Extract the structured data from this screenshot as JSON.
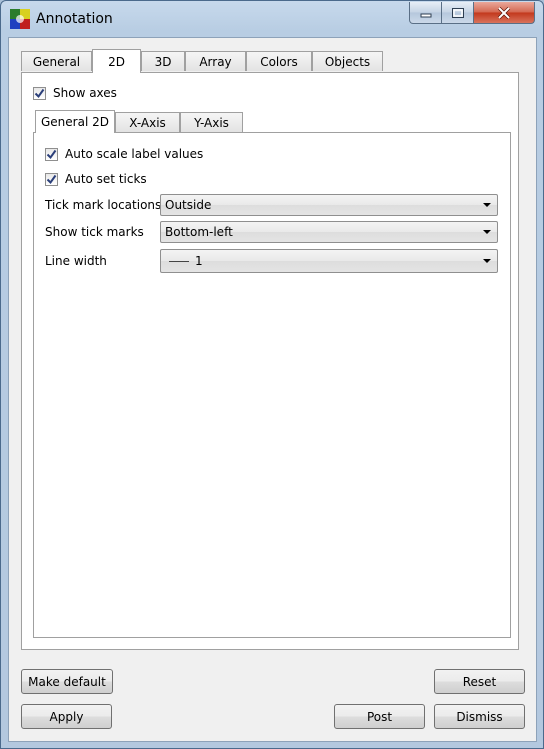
{
  "window": {
    "title": "Annotation",
    "icon": "annotation-app-icon",
    "controls": [
      "minimize-icon",
      "maximize-icon",
      "close-icon"
    ]
  },
  "tabs": [
    "General",
    "2D",
    "3D",
    "Array",
    "Colors",
    "Objects"
  ],
  "active_tab": "2D",
  "show_axes": {
    "label": "Show axes",
    "checked": true
  },
  "inner_tabs": [
    "General 2D",
    "X-Axis",
    "Y-Axis"
  ],
  "active_inner_tab": "General 2D",
  "general2d": {
    "auto_scale": {
      "label": "Auto scale label values",
      "checked": true
    },
    "auto_ticks": {
      "label": "Auto set ticks",
      "checked": true
    },
    "tick_locations": {
      "label": "Tick mark locations",
      "value": "Outside"
    },
    "show_ticks": {
      "label": "Show tick marks",
      "value": "Bottom-left"
    },
    "line_width": {
      "label": "Line width",
      "value": "1"
    }
  },
  "buttons": {
    "make_default": "Make default",
    "reset": "Reset",
    "apply": "Apply",
    "post": "Post",
    "dismiss": "Dismiss"
  }
}
